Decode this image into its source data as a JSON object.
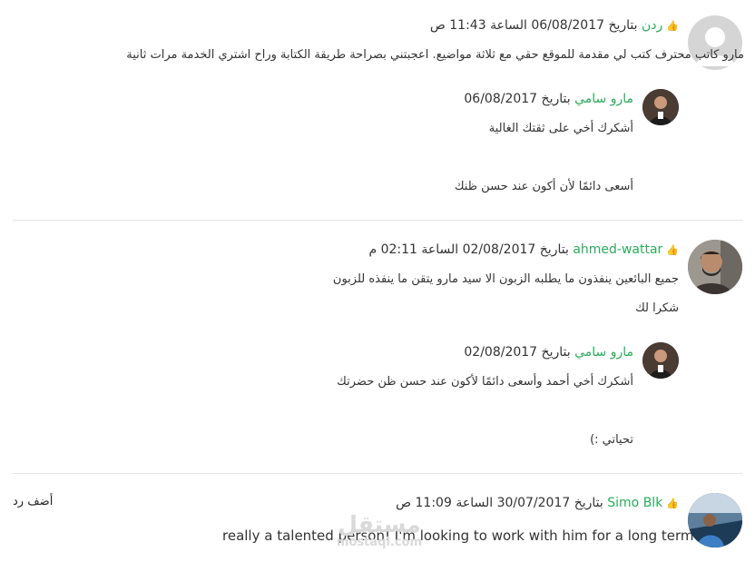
{
  "comments": [
    {
      "author": "ردن",
      "date_prefix": "بتاريخ",
      "date": "06/08/2017",
      "time_prefix": "الساعة",
      "time": "11:43",
      "period": "ص",
      "text": "مارو كاتب محترف كتب لي مقدمة للموقع حقي مع ثلاثة مواضيع. اعجبتني بصراحة طريقة الكتابة وراح اشتري الخدمة مرات ثانية",
      "reply": {
        "author": "مارو سامي",
        "date_prefix": "بتاريخ",
        "date": "06/08/2017",
        "line1": "أشكرك أخي على ثقتك الغالية",
        "line2": "أسعى دائمًا لأن أكون عند حسن ظنك"
      }
    },
    {
      "author": "ahmed-wattar",
      "date_prefix": "بتاريخ",
      "date": "02/08/2017",
      "time_prefix": "الساعة",
      "time": "02:11",
      "period": "م",
      "line1": "جميع البائعين ينفذون ما يطلبه الزبون الا سيد مارو يتقن ما ينفذه للزبون",
      "line2": "شكرا لك",
      "reply": {
        "author": "مارو سامي",
        "date_prefix": "بتاريخ",
        "date": "02/08/2017",
        "line1": "أشكرك أخي أحمد وأسعى دائمًا لأكون عند حسن ظن حضرتك",
        "line2": "تحياتي :)"
      }
    },
    {
      "author": "Simo Blk",
      "date_prefix": "بتاريخ",
      "date": "30/07/2017",
      "time_prefix": "الساعة",
      "time": "11:09",
      "period": "ص",
      "text": "really a talented person! I'm looking to work with him for a long term"
    }
  ],
  "add_reply_label": "أضف رد",
  "watermark": {
    "arabic": "مستقل",
    "latin": "mostaql.com"
  },
  "colors": {
    "author_name": "#2bab5c",
    "divider": "#e5e5e5"
  },
  "icons": {
    "thumb": "thumbs-up-icon"
  }
}
